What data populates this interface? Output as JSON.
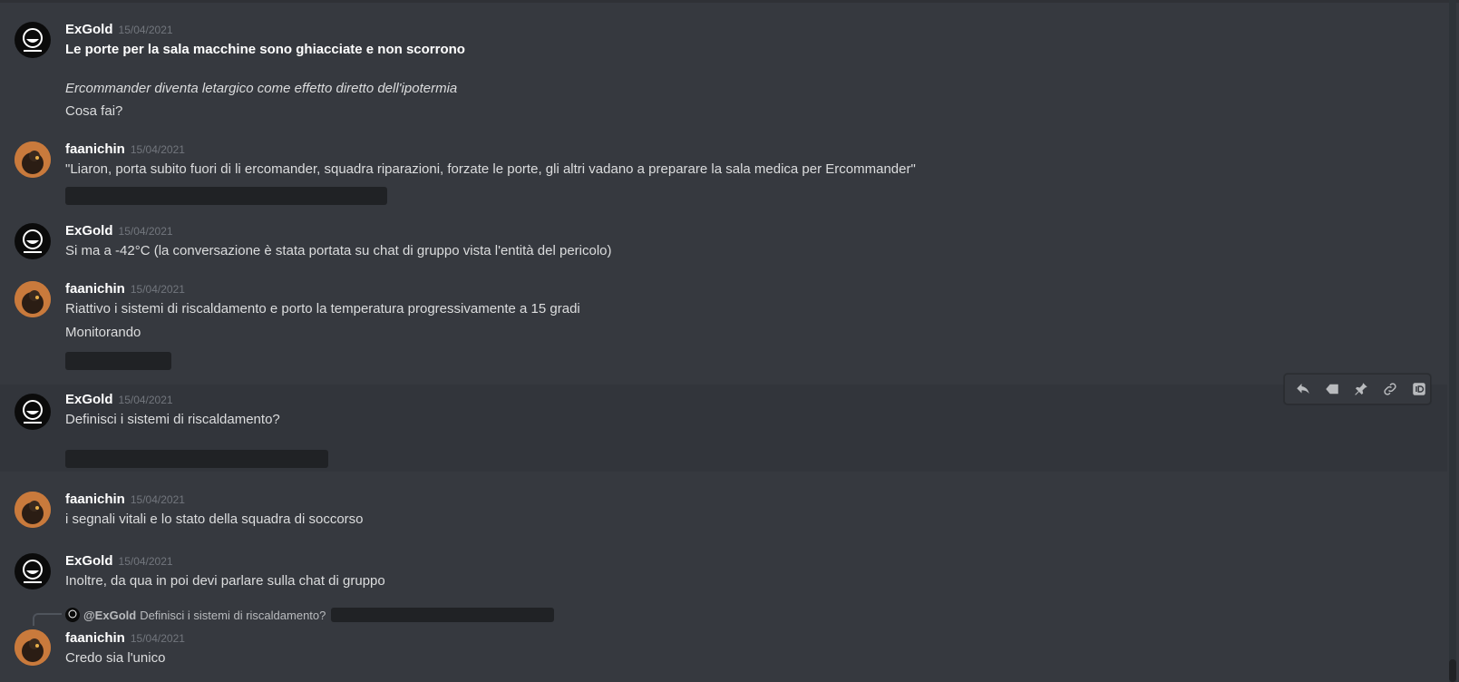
{
  "messages": [
    {
      "author": "ExGold",
      "timestamp": "15/04/2021",
      "lines": [
        "Le porte per la sala macchine sono ghiacciate e non scorrono",
        "Ercommander diventa letargico come effetto diretto dell'ipotermia",
        "Cosa fai?"
      ]
    },
    {
      "author": "faanichin",
      "timestamp": "15/04/2021",
      "lines": [
        "\"Liaron, porta subito fuori di li ercomander, squadra riparazioni, forzate le porte, gli altri vadano a preparare la sala medica per Ercommander\""
      ]
    },
    {
      "author": "ExGold",
      "timestamp": "15/04/2021",
      "lines": [
        "Si ma a -42°C (la conversazione è stata portata su chat di gruppo vista l'entità del pericolo)"
      ]
    },
    {
      "author": "faanichin",
      "timestamp": "15/04/2021",
      "lines": [
        "Riattivo i sistemi di riscaldamento e porto la temperatura progressivamente a 15 gradi",
        "Monitorando"
      ]
    },
    {
      "author": "ExGold",
      "timestamp": "15/04/2021",
      "lines": [
        "Definisci i sistemi di riscaldamento?"
      ]
    },
    {
      "author": "faanichin",
      "timestamp": "15/04/2021",
      "lines": [
        "i segnali vitali e lo stato della squadra di soccorso"
      ]
    },
    {
      "author": "ExGold",
      "timestamp": "15/04/2021",
      "lines": [
        "Inoltre, da qua in poi devi parlare sulla chat di gruppo"
      ]
    },
    {
      "author": "faanichin",
      "timestamp": "15/04/2021",
      "lines": [
        "Credo sia l'unico"
      ],
      "reply": {
        "mention": "@ExGold",
        "text": "Definisci i sistemi di riscaldamento?"
      }
    }
  ],
  "toolbar": {
    "icons": [
      "reply-icon",
      "mark-unread-icon",
      "pin-icon",
      "copy-link-icon",
      "copy-id-icon"
    ]
  },
  "colors": {
    "background": "#36393f",
    "text": "#dcddde",
    "username": "#ffffff",
    "timestamp": "#72767d",
    "spoiler": "#202225"
  }
}
